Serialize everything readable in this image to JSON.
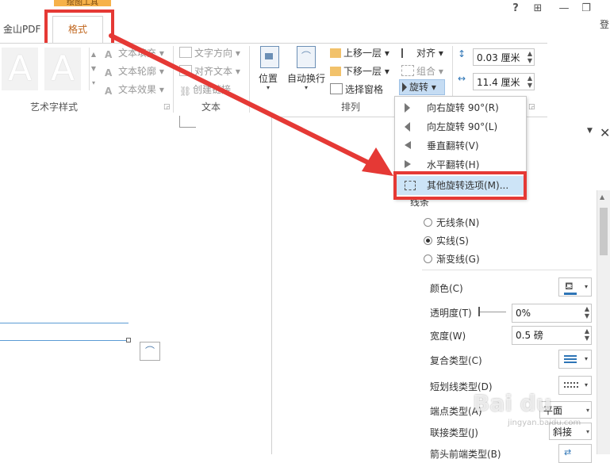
{
  "tabbar": {
    "tool_label": "绘图工具",
    "tab_jinshan": "金山PDF",
    "tab_format": "格式",
    "help": "?",
    "restore_ribbon": "⊞",
    "minimize": "—",
    "restore": "❐",
    "login": "登"
  },
  "ribbon": {
    "art_styles": {
      "label": "艺术字样式",
      "letter": "A",
      "fill": "文本填充",
      "outline": "文本轮廓",
      "effects": "文本效果"
    },
    "text": {
      "label": "文本",
      "direction": "文字方向",
      "align": "对齐文本",
      "link": "创建链接"
    },
    "arrange": {
      "label": "排列",
      "position": "位置",
      "wrap": "自动换行",
      "forward": "上移一层",
      "backward": "下移一层",
      "selection_pane": "选择窗格",
      "align": "对齐",
      "group": "组合",
      "rotate": "旋转"
    },
    "size": {
      "height": "0.03 厘米",
      "width": "11.4 厘米"
    }
  },
  "rotate_menu": [
    {
      "label": "向右旋转 90°(R)",
      "icon": "rotate-right-icon"
    },
    {
      "label": "向左旋转 90°(L)",
      "icon": "rotate-left-icon"
    },
    {
      "label": "垂直翻转(V)",
      "icon": "flip-vertical-icon"
    },
    {
      "label": "水平翻转(H)",
      "icon": "flip-horizontal-icon"
    },
    {
      "label": "其他旋转选项(M)...",
      "icon": "more-rotation-icon"
    }
  ],
  "pane": {
    "section": "线条",
    "line_none": "无线条(N)",
    "line_solid": "实线(S)",
    "line_gradient": "渐变线(G)",
    "color": "颜色(C)",
    "transparency": "透明度(T)",
    "transparency_value": "0%",
    "width": "宽度(W)",
    "width_value": "0.5 磅",
    "compound": "复合类型(C)",
    "dash": "短划线类型(D)",
    "cap": "端点类型(A)",
    "cap_value": "平面",
    "join": "联接类型(J)",
    "join_value": "斜接",
    "arrow": "箭头前端类型(B)"
  },
  "watermark": {
    "logo": "Bai du",
    "url": "jingyan.baidu.com"
  },
  "colors": {
    "accent_red": "#e53935",
    "tab_orange": "#c0651c",
    "tool_orange": "#f6b24a",
    "line_blue": "#5b9bd5"
  }
}
